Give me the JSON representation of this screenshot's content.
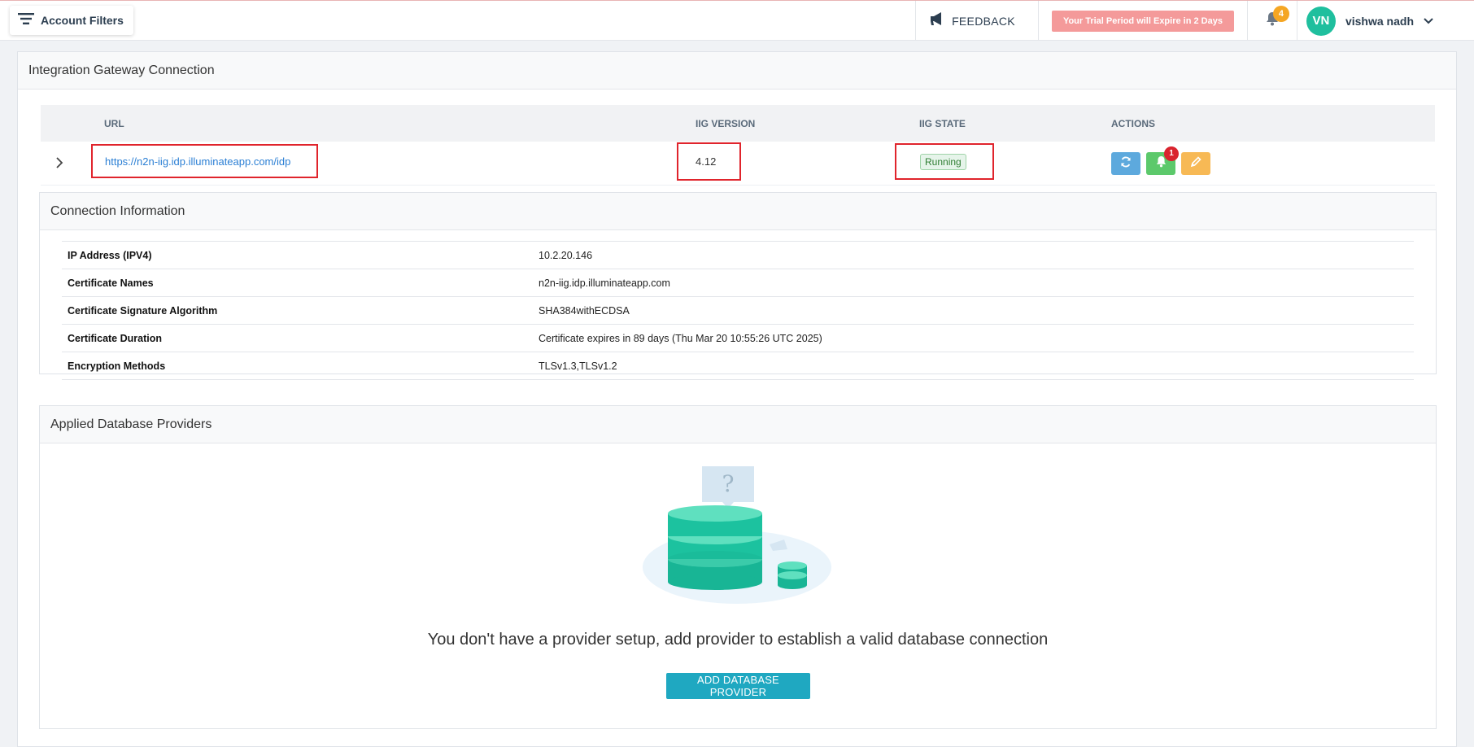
{
  "topbar": {
    "account_filters_label": "Account Filters",
    "feedback_label": "FEEDBACK",
    "trial_notice": "Your Trial Period will Expire in 2 Days",
    "notification_count": "4",
    "user_initials": "VN",
    "user_name": "vishwa nadh"
  },
  "gateway": {
    "title": "Integration Gateway Connection",
    "columns": {
      "url": "URL",
      "version": "IIG VERSION",
      "state": "IIG STATE",
      "actions": "ACTIONS"
    },
    "row": {
      "url": "https://n2n-iig.idp.illuminateapp.com/idp",
      "version": "4.12",
      "state": "Running",
      "alert_count": "1"
    }
  },
  "connection_info": {
    "title": "Connection Information",
    "rows": [
      {
        "label": "IP Address (IPV4)",
        "value": "10.2.20.146"
      },
      {
        "label": "Certificate Names",
        "value": "n2n-iig.idp.illuminateapp.com"
      },
      {
        "label": "Certificate Signature Algorithm",
        "value": "SHA384withECDSA"
      },
      {
        "label": "Certificate Duration",
        "value": "Certificate expires in 89 days (Thu Mar 20 10:55:26 UTC 2025)"
      },
      {
        "label": "Encryption Methods",
        "value": "TLSv1.3,TLSv1.2"
      }
    ]
  },
  "providers": {
    "title": "Applied Database Providers",
    "empty_message": "You don't have a provider setup, add provider to establish a valid database connection",
    "add_button_label": "ADD DATABASE PROVIDER"
  },
  "colors": {
    "accent": "#1fa8c1",
    "link": "#2b7fd4",
    "highlight_box": "#e0242c",
    "refresh_button": "#5da9dd",
    "alert_button": "#5cc96b",
    "edit_button": "#f7b955"
  }
}
